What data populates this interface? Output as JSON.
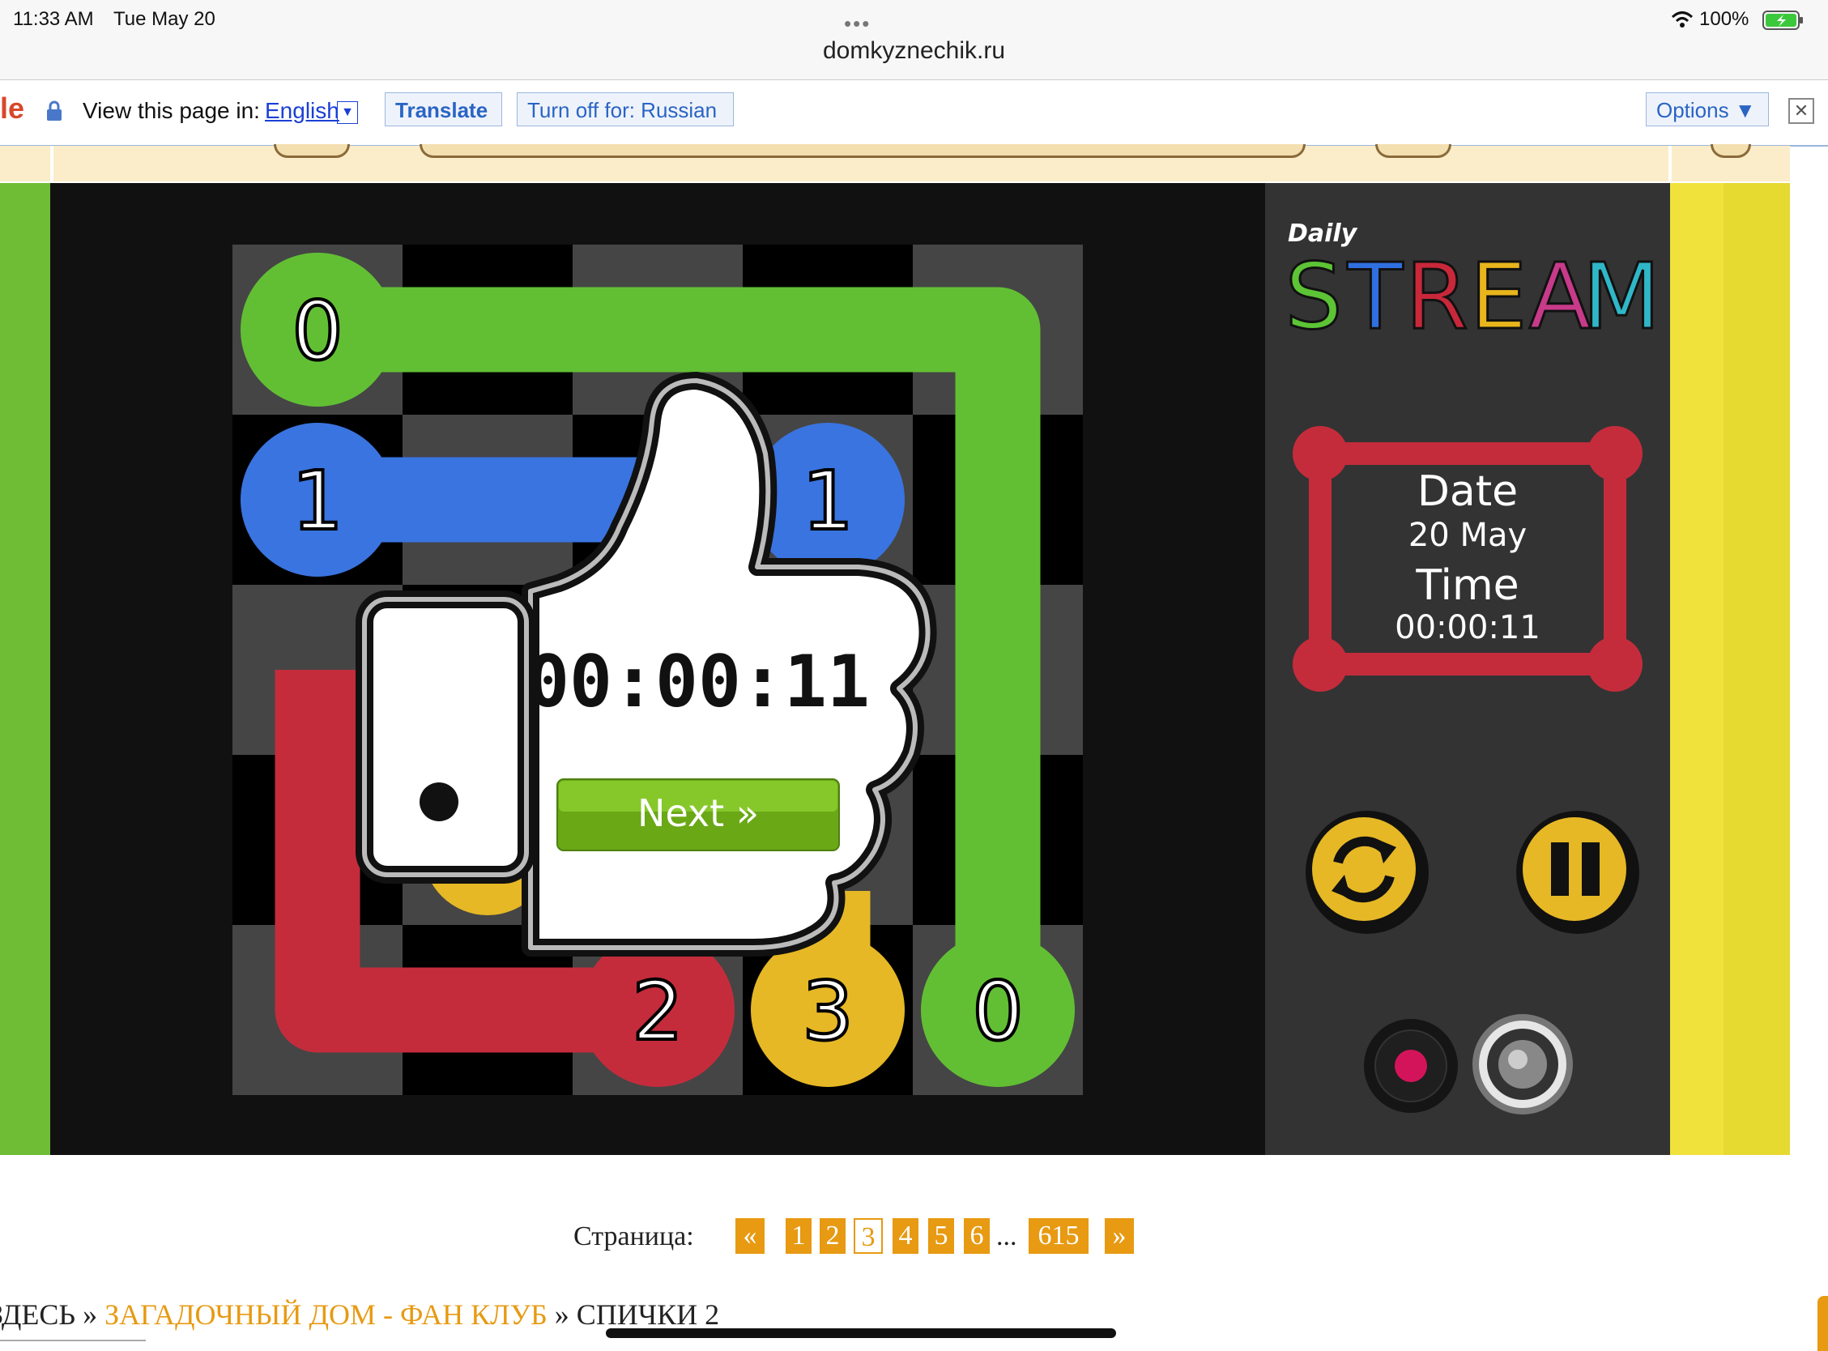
{
  "status_bar": {
    "time": "11:33 AM",
    "date": "Tue May 20",
    "battery": "100%",
    "url": "domkyznechik.ru"
  },
  "translate_bar": {
    "logo_fragment": "le",
    "prompt": "View this page in:",
    "language": "English",
    "translate_button": "Translate",
    "turn_off_button": "Turn off for: Russian",
    "options_button": "Options ▼",
    "close_symbol": "✕"
  },
  "game": {
    "logo_small": "Daily",
    "logo_big": "STREAM",
    "logo_colors": [
      "#5cc435",
      "#2f6fe0",
      "#c8283a",
      "#e8b51c",
      "#c83a8a",
      "#2fb7c8"
    ],
    "date_label": "Date",
    "date_value": "20 May",
    "time_label": "Time",
    "time_value": "00:00:11",
    "popup_time": "00:00:11",
    "next_button": "Next »",
    "cell_numbers": {
      "green_top": "0",
      "blue_left": "1",
      "blue_right": "1",
      "red": "2",
      "yellow": "3",
      "green_bottom": "0"
    },
    "colors": {
      "green": "#62bf34",
      "blue": "#3a74e0",
      "red": "#c42c3c",
      "yellow": "#e6b825"
    }
  },
  "pagination": {
    "label": "Страница:",
    "prev": "«",
    "pages": [
      "1",
      "2",
      "3",
      "4",
      "5",
      "6"
    ],
    "current": "3",
    "ellipsis": "...",
    "last": "615",
    "next": "»"
  },
  "breadcrumb": {
    "start": "ЗДЕСЬ",
    "sep": "»",
    "link": "ЗАГАДОЧНЫЙ ДОМ - ФАН КЛУБ",
    "current": "СПИЧКИ 2"
  }
}
